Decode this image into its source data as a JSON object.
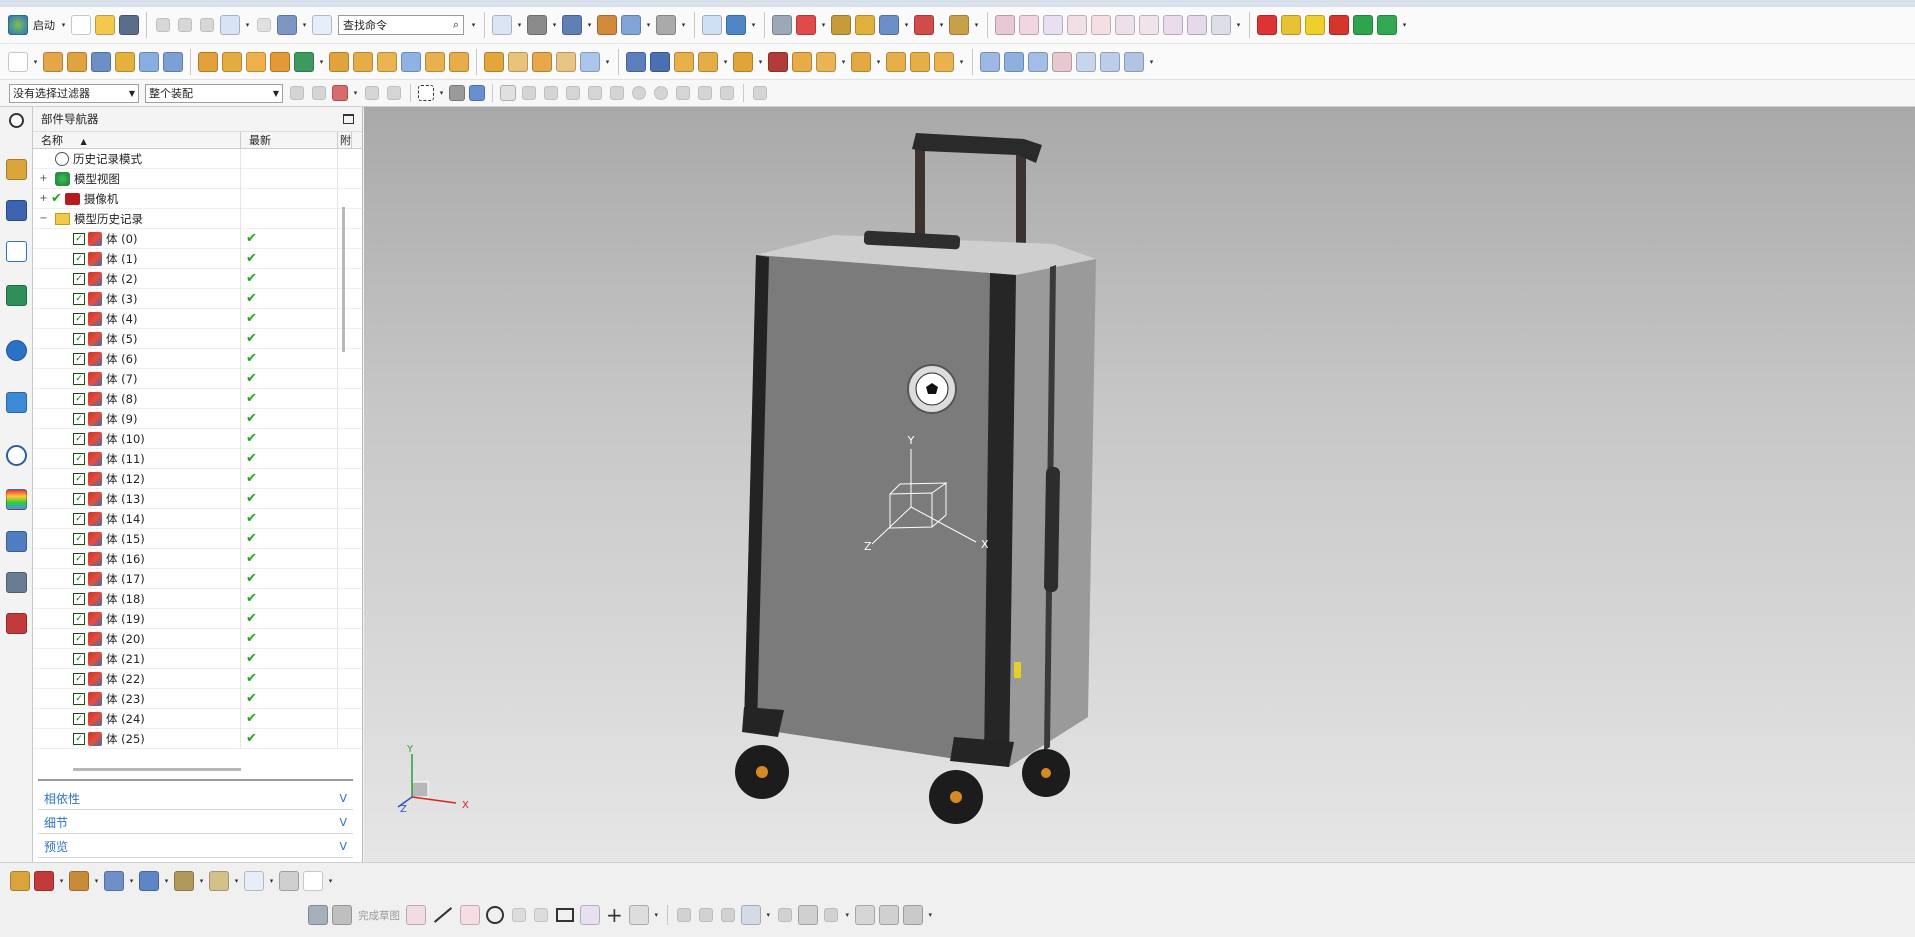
{
  "toolbar": {
    "start_label": "启动",
    "search_placeholder": "查找命令",
    "selection_filter": "没有选择过滤器",
    "assembly_scope": "整个装配"
  },
  "navigator": {
    "title": "部件导航器",
    "columns": [
      "名称",
      "最新",
      "附"
    ],
    "items": [
      {
        "label": "历史记录模式"
      },
      {
        "label": "模型视图"
      },
      {
        "label": "摄像机"
      },
      {
        "label": "模型历史记录"
      }
    ],
    "bodies": [
      "体 (0)",
      "体 (1)",
      "体 (2)",
      "体 (3)",
      "体 (4)",
      "体 (5)",
      "体 (6)",
      "体 (7)",
      "体 (8)",
      "体 (9)",
      "体 (10)",
      "体 (11)",
      "体 (12)",
      "体 (13)",
      "体 (14)",
      "体 (15)",
      "体 (16)",
      "体 (17)",
      "体 (18)",
      "体 (19)",
      "体 (20)",
      "体 (21)",
      "体 (22)",
      "体 (23)",
      "体 (24)",
      "体 (25)"
    ],
    "panels": {
      "dependencies": "相依性",
      "details": "细节",
      "preview": "预览"
    }
  },
  "viewport": {
    "axis_x": "X",
    "axis_y": "Y",
    "axis_z": "Z"
  },
  "sketch_toolbar": {
    "finish_label": "完成草图"
  },
  "colors": {
    "accent": "#2b72c6",
    "check": "#1ea51e",
    "viewport_top": "#a9a9a9",
    "viewport_bottom": "#e6e6e6"
  },
  "icons": [
    "start-icon",
    "new-icon",
    "open-icon",
    "save-icon",
    "cut-icon",
    "copy-icon",
    "paste-icon",
    "undo-icon",
    "redo-icon",
    "search-icon",
    "fit-icon",
    "shade-icon",
    "extrude-icon",
    "sketch-icon",
    "measure-icon"
  ]
}
